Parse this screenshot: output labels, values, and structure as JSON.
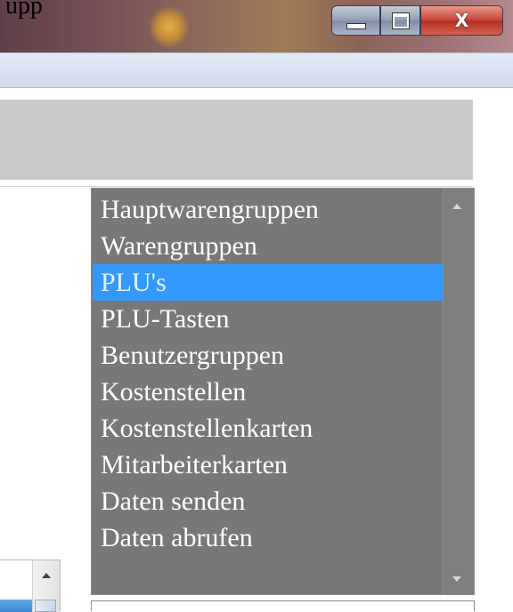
{
  "window": {
    "title_fragment": "upp"
  },
  "controls": {
    "minimize_icon": "minimize-icon",
    "maximize_icon": "maximize-icon",
    "close_icon": "close-icon",
    "close_glyph": "X",
    "close_color": "#c8453a"
  },
  "listbox": {
    "items": [
      {
        "label": "Hauptwarengruppen",
        "selected": false
      },
      {
        "label": "Warengruppen",
        "selected": false
      },
      {
        "label": "PLU's",
        "selected": true
      },
      {
        "label": "PLU-Tasten",
        "selected": false
      },
      {
        "label": "Benutzergruppen",
        "selected": false
      },
      {
        "label": "Kostenstellen",
        "selected": false
      },
      {
        "label": "Kostenstellenkarten",
        "selected": false
      },
      {
        "label": "Mitarbeiterkarten",
        "selected": false
      },
      {
        "label": "Daten senden",
        "selected": false
      },
      {
        "label": "Daten abrufen",
        "selected": false
      }
    ],
    "background": "#787878",
    "selection_color": "#3399ff",
    "text_color": "#ffffff"
  }
}
